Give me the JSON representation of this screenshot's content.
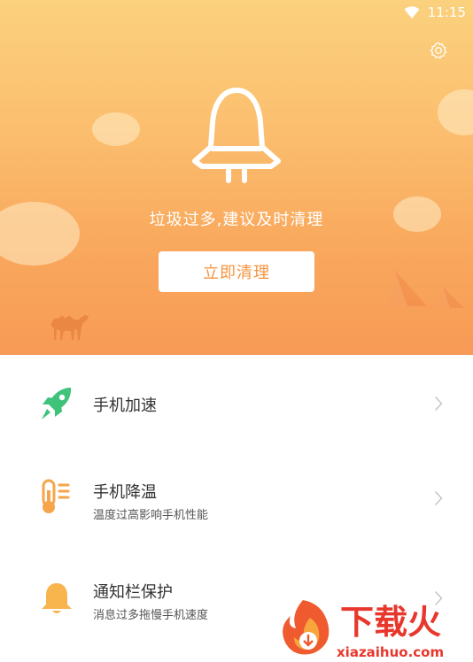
{
  "status_bar": {
    "time": "11:15"
  },
  "icons": {
    "wifi": "wifi-icon",
    "settings": "gear-icon",
    "rocket": "rocket-outline-icon",
    "camel": "camel-icon",
    "boost": "green-rocket-icon",
    "cooling": "thermometer-icon",
    "notify": "bell-icon",
    "chevron": "chevron-right-icon"
  },
  "hero": {
    "message": "垃圾过多,建议及时清理",
    "clean_button_label": "立即清理"
  },
  "menu": {
    "items": [
      {
        "title": "手机加速",
        "subtitle": ""
      },
      {
        "title": "手机降温",
        "subtitle": "温度过高影响手机性能"
      },
      {
        "title": "通知栏保护",
        "subtitle": "消息过多拖慢手机速度"
      }
    ]
  },
  "watermark": {
    "brand": "下载火",
    "domain": "xiazaihuo.com"
  },
  "colors": {
    "hero_top": "#fbd17e",
    "hero_bottom": "#f79a55",
    "button_text": "#f6943f",
    "boost_icon": "#3fc27a",
    "cooling_icon": "#f6a54a",
    "notify_icon": "#f8b44d",
    "watermark_red": "#e8372c"
  }
}
